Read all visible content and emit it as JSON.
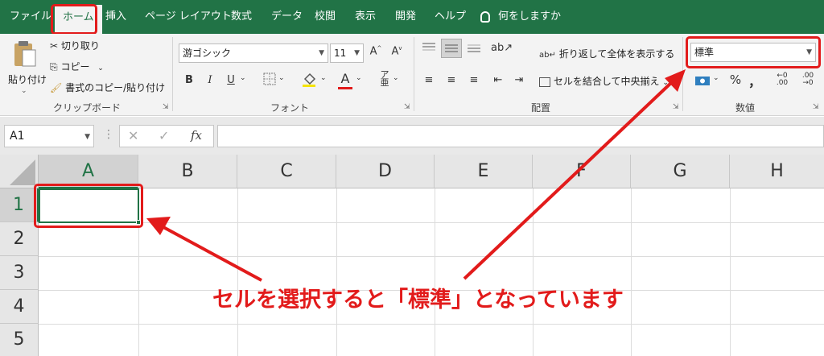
{
  "ribbon_tabs": [
    "ファイル",
    "ホーム",
    "挿入",
    "ページ レイアウト",
    "数式",
    "データ",
    "校閲",
    "表示",
    "開発",
    "ヘルプ"
  ],
  "tell_me": "何をしますか",
  "clipboard": {
    "paste": "貼り付け",
    "cut": "切り取り",
    "copy": "コピー",
    "format_painter": "書式のコピー/貼り付け",
    "group": "クリップボード"
  },
  "font": {
    "name": "游ゴシック",
    "size": "11",
    "bold": "B",
    "italic": "I",
    "underline": "U",
    "color_letter": "A",
    "group": "フォント"
  },
  "alignment": {
    "wrap_text": "折り返して全体を表示する",
    "merge_center": "セルを結合して中央揃え",
    "group": "配置"
  },
  "number": {
    "format": "標準",
    "percent": "%",
    "comma": "，",
    "inc_decimal": "←0 .00",
    "dec_decimal": ".00 →0",
    "group": "数値"
  },
  "formula_bar": {
    "name_box": "A1",
    "fx": "fx"
  },
  "sheet": {
    "columns": [
      "A",
      "B",
      "C",
      "D",
      "E",
      "F",
      "G",
      "H"
    ],
    "rows": [
      "1",
      "2",
      "3",
      "4",
      "5"
    ]
  },
  "annotation": "セルを選択すると「標準」となっています",
  "colors": {
    "excel_green": "#217346",
    "annotation_red": "#e21b1b"
  }
}
